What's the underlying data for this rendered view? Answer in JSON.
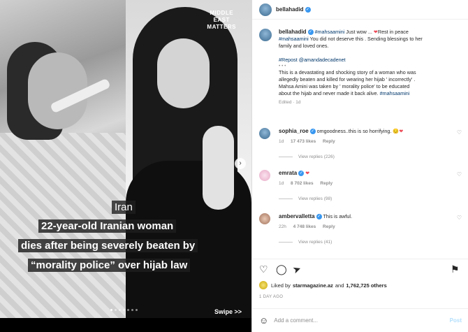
{
  "media": {
    "outlet_logo": [
      "MIDDLE",
      "EAST",
      "MATTERS"
    ],
    "location_tag": "Iran",
    "headline": [
      "22-year-old Iranian woman",
      "dies after being severely beaten by",
      "“morality police” over hijab law"
    ],
    "swipe_label": "Swipe >>",
    "next_icon": "chevron-right-icon",
    "carousel_pages": 7,
    "carousel_active_index": 0
  },
  "header": {
    "username": "bellahadid",
    "verified_icon": "verified-badge-icon"
  },
  "caption": {
    "username": "bellahadid",
    "line1_tag": "#mahsaamini",
    "line1_text": " Just wow ... ",
    "heart_glyph": "❤",
    "line1_end": "Rest in peace",
    "line2_tag": "#mahsaamini",
    "line2_text": " You did not deserve this . Sending blessings to her",
    "line3_text": "family and loved ones.",
    "repost_label": "#Repost @amandadecadenet",
    "dots": "• • •",
    "story1": "This is a devastating and shocking story of a woman who was",
    "story2": "allegedly beaten and killed for wearing her hijab ' incorrectly' .",
    "story3": "Mahsa Amini was taken by ' morality police' to be educated",
    "story4_text": "about the hijab and never made it back alive. ",
    "story4_tag": "#mahsaamini",
    "edited": "Edited · 1d"
  },
  "comments": [
    {
      "username": "sophia_roe",
      "text": " omgoodness..this is so horrifying. ",
      "emoji1": "😔",
      "emoji2": "❤",
      "age": "1d",
      "likes": "17 473 likes",
      "reply": "Reply",
      "view_replies": "View replies (226)"
    },
    {
      "username": "emrata",
      "text": " ",
      "emoji1": "❤",
      "emoji2": "",
      "age": "1d",
      "likes": "8 702 likes",
      "reply": "Reply",
      "view_replies": "View replies (98)"
    },
    {
      "username": "ambervalletta",
      "text": " This is awful.",
      "emoji1": "",
      "emoji2": "",
      "age": "22h",
      "likes": "4 748 likes",
      "reply": "Reply",
      "view_replies": "View replies (41)"
    }
  ],
  "actions": {
    "like_icon": "♡",
    "comment_icon": "◯",
    "share_icon": "➤",
    "save_icon": "⚑"
  },
  "likes_line": {
    "prefix": "Liked by",
    "user": "starmagazine.az",
    "middle": " and ",
    "count": "1,762,725 others"
  },
  "time_ago": "1 DAY AGO",
  "add_comment": {
    "emoji_icon": "☺",
    "placeholder": "Add a comment...",
    "post_label": "Post"
  }
}
